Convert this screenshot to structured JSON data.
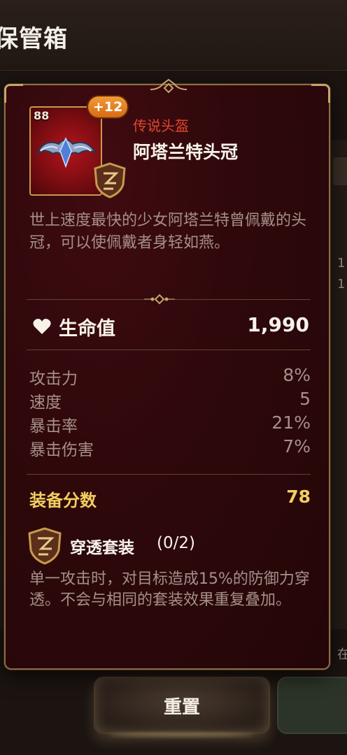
{
  "background": {
    "title": "保管箱",
    "right_edge_text": [
      "1",
      "1",
      "在"
    ],
    "reset_button": "重置"
  },
  "item": {
    "level": "88",
    "enhancement": "+12",
    "grade": "传说头盔",
    "name": "阿塔兰特头冠",
    "description": "世上速度最快的少女阿塔兰特曾佩戴的头冠，可以使佩戴者身轻如燕。",
    "main_stat": {
      "label": "生命值",
      "value": "1,990",
      "icon": "heart-icon"
    },
    "sub_stats": [
      {
        "label": "攻击力",
        "value": "8%"
      },
      {
        "label": "速度",
        "value": "5"
      },
      {
        "label": "暴击率",
        "value": "21%"
      },
      {
        "label": "暴击伤害",
        "value": "7%"
      }
    ],
    "gear_score": {
      "label": "装备分数",
      "value": "78"
    },
    "set": {
      "name": "穿透套装",
      "count": "(0/2)",
      "description": "单一攻击时，对目标造成15%的防御力穿透。不会与相同的套装效果重复叠加。",
      "icon": "penetration-set-icon"
    }
  },
  "colors": {
    "card_bg": "#2e080b",
    "border_gold": "#c9a36a",
    "grade_red": "#e4452f",
    "score_yellow": "#f2cf5f",
    "enhance_orange": "#f39a36"
  }
}
